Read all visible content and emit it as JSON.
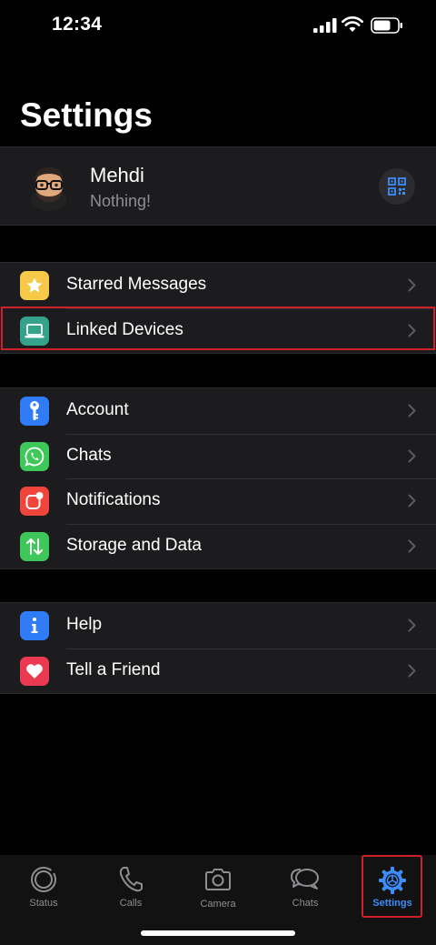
{
  "status_bar": {
    "time": "12:34"
  },
  "title": "Settings",
  "profile": {
    "name": "Mehdi",
    "status": "Nothing!"
  },
  "groups": [
    [
      {
        "label": "Starred Messages",
        "icon": "star-icon",
        "color": "#f7c948"
      },
      {
        "label": "Linked Devices",
        "icon": "laptop-icon",
        "color": "#35a28c"
      }
    ],
    [
      {
        "label": "Account",
        "icon": "key-icon",
        "color": "#2f7cf6"
      },
      {
        "label": "Chats",
        "icon": "whatsapp-icon",
        "color": "#3fc85a"
      },
      {
        "label": "Notifications",
        "icon": "notification-icon",
        "color": "#f0453a"
      },
      {
        "label": "Storage and Data",
        "icon": "updown-arrows-icon",
        "color": "#3fc85a"
      }
    ],
    [
      {
        "label": "Help",
        "icon": "info-icon",
        "color": "#2f7cf6"
      },
      {
        "label": "Tell a Friend",
        "icon": "heart-icon",
        "color": "#ea3a52"
      }
    ]
  ],
  "tabs": [
    {
      "label": "Status",
      "icon": "status-icon"
    },
    {
      "label": "Calls",
      "icon": "phone-icon"
    },
    {
      "label": "Camera",
      "icon": "camera-icon"
    },
    {
      "label": "Chats",
      "icon": "chats-icon"
    },
    {
      "label": "Settings",
      "icon": "settings-gear-icon",
      "active": true
    }
  ],
  "colors": {
    "accent": "#3b8dff",
    "highlight": "#d0202a",
    "background": "#000000",
    "cell": "#1c1c1e"
  }
}
